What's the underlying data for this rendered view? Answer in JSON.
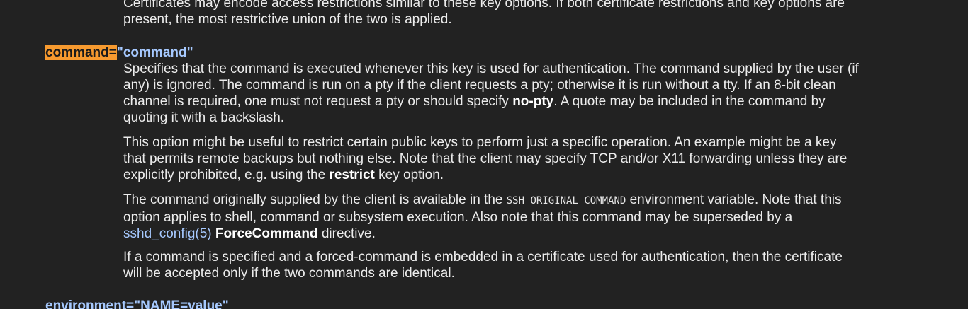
{
  "intro": {
    "line1": "Certificates may encode access restrictions similar to these key options. If both certificate restrictions and key options are",
    "line2": "present, the most restrictive union of the two is applied."
  },
  "command_option": {
    "highlighted_term": "command=",
    "value_term": "\"command\"",
    "p1": {
      "line1": "Specifies that the command is executed whenever this key is used for authentication. The command supplied by the user (if",
      "line2": "any) is ignored. The command is run on a pty if the client requests a pty; otherwise it is run without a tty. If an 8-bit clean",
      "line3_a": "channel is required, one must not request a pty or should specify ",
      "line3_bold": "no-pty",
      "line3_b": ". A quote may be included in the command by",
      "line4": "quoting it with a backslash."
    },
    "p2": {
      "line1": "This option might be useful to restrict certain public keys to perform just a specific operation. An example might be a key",
      "line2": "that permits remote backups but nothing else. Note that the client may specify TCP and/or X11 forwarding unless they are",
      "line3_a": "explicitly prohibited, e.g. using the ",
      "line3_bold": "restrict",
      "line3_b": " key option."
    },
    "p3": {
      "line1_a": "The command originally supplied by the client is available in the ",
      "line1_code": "SSH_ORIGINAL_COMMAND",
      "line1_b": " environment variable. Note that this",
      "line2": "option applies to shell, command or subsystem execution. Also note that this command may be superseded by a",
      "link_text": "sshd_config(5)",
      "line3_bold": "ForceCommand",
      "line3_b": " directive."
    },
    "p4": {
      "line1": "If a command is specified and a forced-command is embedded in a certificate used for authentication, then the certificate",
      "line2": "will be accepted only if the two commands are identical."
    }
  },
  "next_option": {
    "term": "environment=\"NAME=value\""
  },
  "colors": {
    "background": "#222222",
    "text": "#ececec",
    "term": "#a6c9ff",
    "highlight": "#f79a2f"
  }
}
